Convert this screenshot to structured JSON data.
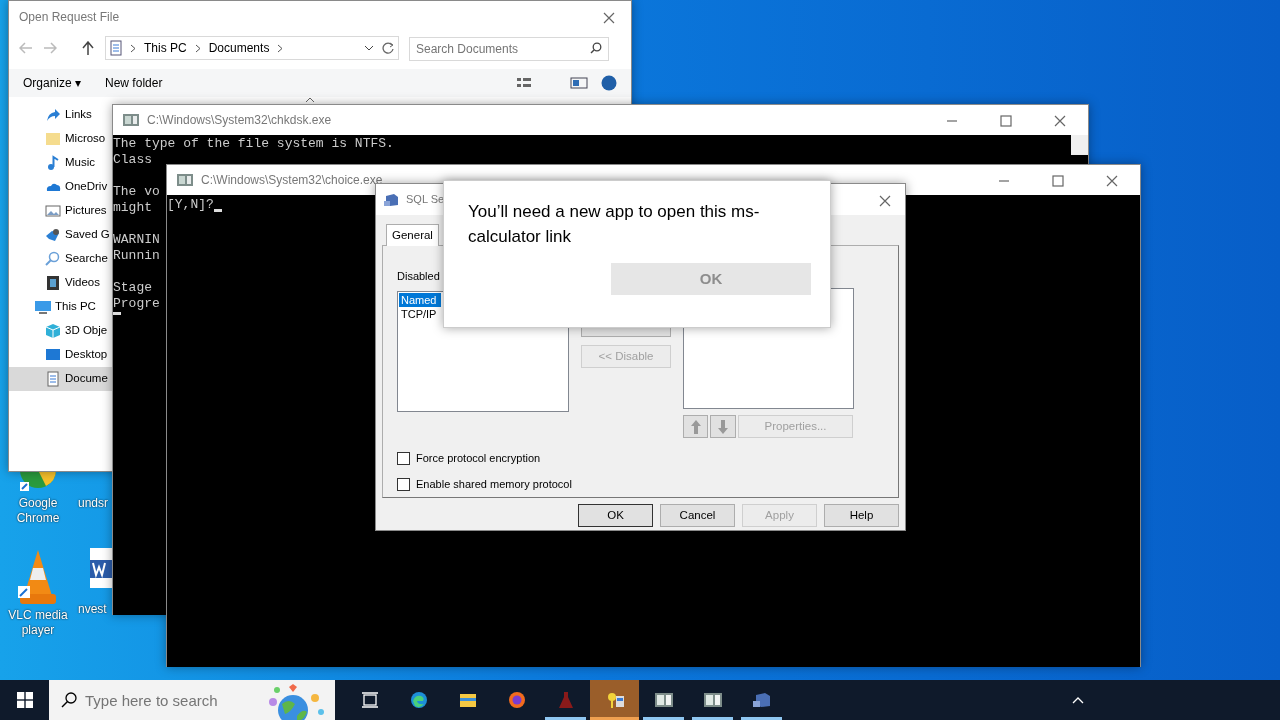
{
  "desktop_icons": [
    {
      "kind": "chrome",
      "label": "Google Chrome"
    },
    {
      "kind": "blank",
      "label": "undsr"
    },
    {
      "kind": "vlc",
      "label": "VLC media player"
    },
    {
      "kind": "word",
      "label": "nvest"
    }
  ],
  "file_dialog": {
    "title": "Open Request File",
    "breadcrumb": [
      "This PC",
      "Documents"
    ],
    "search": {
      "placeholder": "Search Documents"
    },
    "toolbar": [
      "Organize ▾",
      "New folder"
    ],
    "nav_items": [
      {
        "kind": "link",
        "label": "Links",
        "selected": false
      },
      {
        "kind": "folder",
        "label": "Microso",
        "selected": false
      },
      {
        "kind": "music",
        "label": "Music",
        "selected": false
      },
      {
        "kind": "cloud",
        "label": "OneDriv",
        "selected": false
      },
      {
        "kind": "pictures",
        "label": "Pictures",
        "selected": false
      },
      {
        "kind": "saved",
        "label": "Saved G",
        "selected": false
      },
      {
        "kind": "search",
        "label": "Searche",
        "selected": false
      },
      {
        "kind": "videos",
        "label": "Videos",
        "selected": false
      },
      {
        "kind": "pc",
        "label": "This PC",
        "selected": false,
        "children": [
          {
            "kind": "cube",
            "label": "3D Obje",
            "selected": false
          },
          {
            "kind": "desktop",
            "label": "Desktop",
            "selected": false
          },
          {
            "kind": "document",
            "label": "Docume",
            "selected": true
          }
        ]
      }
    ]
  },
  "chkdsk": {
    "title": "C:\\Windows\\System32\\chkdsk.exe",
    "paragraphs": [
      [
        "The type of the file system is NTFS.",
        "Class"
      ],
      [
        "The vo",
        "might"
      ],
      [
        "WARNIN",
        "Runnin"
      ],
      [
        "Stage",
        "Progre"
      ]
    ]
  },
  "choice": {
    "title": "C:\\Windows\\System32\\choice.exe",
    "prompt": "[Y,N]?"
  },
  "sql_dialog": {
    "title": "SQL Se",
    "tabs": [
      {
        "label": "General",
        "selected": true
      }
    ],
    "list_label": "Disabled",
    "disabled_list": [
      {
        "label": "Named",
        "selected": true
      },
      {
        "label": "TCP/IP",
        "selected": false
      }
    ],
    "disable_button": {
      "label": "<< Disable",
      "disabled": true
    },
    "properties_button": {
      "label": "Properties...",
      "disabled": true
    },
    "checkboxes": [
      {
        "label": "Force protocol encryption",
        "checked": false
      },
      {
        "label": "Enable shared memory protocol",
        "checked": false
      }
    ],
    "buttons": [
      {
        "label": "OK",
        "disabled": false
      },
      {
        "label": "Cancel",
        "disabled": false
      },
      {
        "label": "Apply",
        "disabled": true
      },
      {
        "label": "Help",
        "disabled": false
      }
    ]
  },
  "popup": {
    "message": "You’ll need a new app to open this ms-calculator link",
    "button": "OK"
  },
  "taskbar": {
    "search_placeholder": "Type here to search",
    "apps": [
      {
        "kind": "taskview",
        "running": false,
        "active": false
      },
      {
        "kind": "edge",
        "running": false,
        "active": false
      },
      {
        "kind": "explorer",
        "running": false,
        "active": false
      },
      {
        "kind": "firefox",
        "running": false,
        "active": false
      },
      {
        "kind": "flask",
        "running": true,
        "active": false
      },
      {
        "kind": "keys",
        "running": true,
        "active": true
      },
      {
        "kind": "console",
        "running": true,
        "active": false
      },
      {
        "kind": "console",
        "running": true,
        "active": false
      },
      {
        "kind": "sqlapp",
        "running": true,
        "active": false
      }
    ]
  }
}
